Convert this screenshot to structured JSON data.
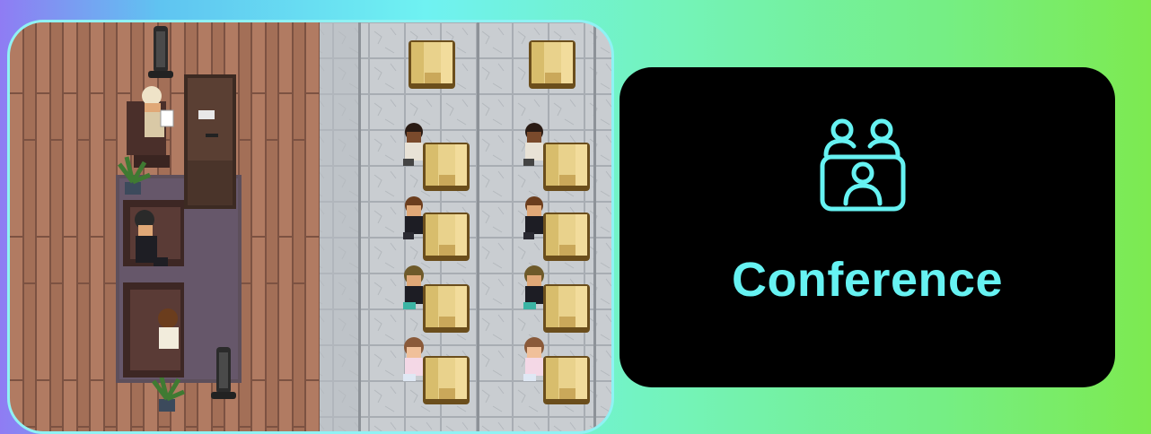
{
  "card": {
    "icon": "conference-people-icon",
    "label": "Conference",
    "accent_color": "#66f2f2"
  },
  "scene": {
    "description_icon": "pixel-office-room-scene"
  }
}
